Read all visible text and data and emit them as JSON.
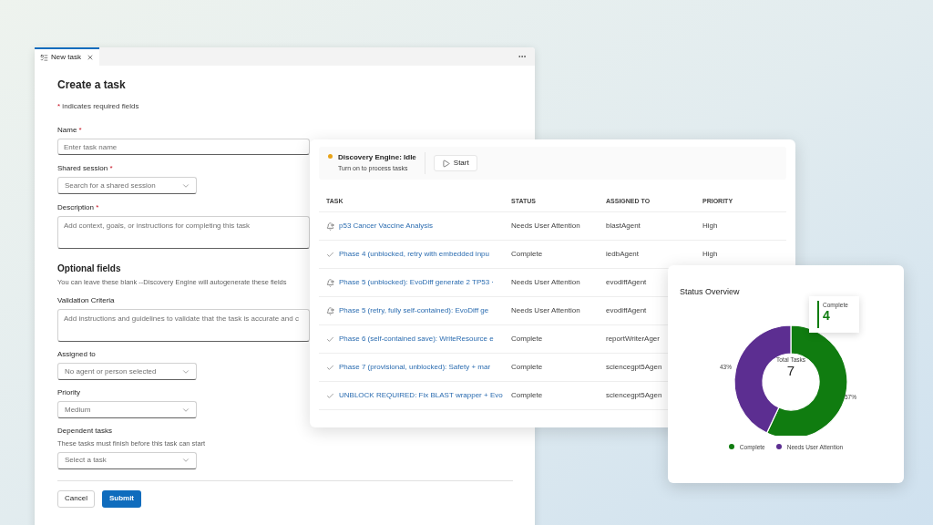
{
  "form_window": {
    "tab": {
      "label": "New task",
      "selected": true
    },
    "title": "Create a task",
    "required_note": {
      "mark": "*",
      "text": "indicates required fields"
    },
    "required_fields": [
      {
        "label": "Name",
        "required": true,
        "kind": "input",
        "placeholder": "Enter task name"
      },
      {
        "label": "Shared session",
        "required": true,
        "kind": "select",
        "placeholder": "Search for a shared session"
      },
      {
        "label": "Description",
        "required": true,
        "kind": "textarea",
        "placeholder": "Add context, goals, or instructions for completing this task"
      }
    ],
    "optional_section": {
      "title": "Optional fields",
      "note": "You can leave these blank --Discovery Engine will autogenerate these fields"
    },
    "optional_fields": [
      {
        "label": "Validation Criteria",
        "required": false,
        "kind": "textarea",
        "placeholder": "Add instructions and guidelines to validate that the task is accurate and c"
      },
      {
        "label": "Assigned to",
        "required": false,
        "kind": "select",
        "placeholder": "No agent or person selected"
      },
      {
        "label": "Priority",
        "required": false,
        "kind": "select",
        "placeholder": "Medium"
      },
      {
        "label": "Dependent tasks",
        "required": false,
        "kind": "select",
        "help": "These tasks must finish before this task can start",
        "placeholder": "Select a task"
      }
    ],
    "buttons": [
      {
        "label": "Cancel",
        "kind": "secondary"
      },
      {
        "label": "Submit",
        "kind": "primary"
      }
    ]
  },
  "task_panel": {
    "engine": {
      "color": "#e8a317",
      "title": "Discovery Engine: Idle",
      "subtitle": "Turn on to process tasks",
      "start_button": "Start"
    },
    "columns": [
      "TASK",
      "STATUS",
      "ASSIGNED TO",
      "PRIORITY"
    ],
    "rows": [
      {
        "kind": "attention",
        "task": "p53 Cancer Vaccine Analysis",
        "status": "Needs User Attention",
        "assigned_to": "blastAgent",
        "priority": "High"
      },
      {
        "kind": "complete",
        "task": "Phase 4 (unblocked, retry with embedded inpu",
        "status": "Complete",
        "assigned_to": "iedbAgent",
        "priority": "High"
      },
      {
        "kind": "attention",
        "task": "Phase 5 (unblocked): EvoDiff generate 2 TP53 ·",
        "status": "Needs User Attention",
        "assigned_to": "evodiffAgent"
      },
      {
        "kind": "attention",
        "task": "Phase 5 (retry, fully self-contained): EvoDiff ge",
        "status": "Needs User Attention",
        "assigned_to": "evodiffAgent"
      },
      {
        "kind": "complete",
        "task": "Phase 6 (self-contained save): WriteResource e",
        "status": "Complete",
        "assigned_to": "reportWriterAger"
      },
      {
        "kind": "complete",
        "task": "Phase 7 (provisional, unblocked): Safety + mar",
        "status": "Complete",
        "assigned_to": "sciencegpt5Agen"
      },
      {
        "kind": "complete",
        "task": "UNBLOCK REQUIRED: Fix BLAST wrapper + Evo",
        "status": "Complete",
        "assigned_to": "sciencegpt5Agen"
      }
    ]
  },
  "status_card": {
    "title": "Status Overview",
    "chart_data": {
      "type": "donut",
      "categories": [
        "Complete",
        "Needs User Attention"
      ],
      "series": [
        {
          "values": [
            57,
            43
          ]
        }
      ],
      "value_labels": [
        "57%",
        "43%"
      ]
    },
    "center": {
      "label": "Total Tasks",
      "value": "7"
    },
    "tooltip": {
      "label": "Complete",
      "value": "4",
      "color": "#107c10"
    },
    "legend": [
      {
        "color": "#107c10"
      },
      {
        "color": "#5c2e91"
      }
    ]
  }
}
